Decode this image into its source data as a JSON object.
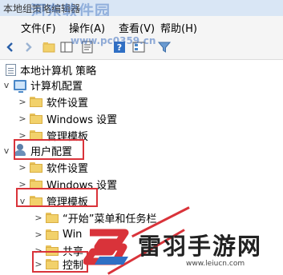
{
  "window": {
    "title": "本地组策略编辑器"
  },
  "watermarks": {
    "top": "河东软件园",
    "url_mid": "www.pc0359.cn",
    "brand": "雷羽手游网",
    "brand_url": "www.leiucn.com"
  },
  "menu": [
    "文件(F)",
    "操作(A)",
    "查看(V)",
    "帮助(H)"
  ],
  "toolbar": {
    "icons": [
      "back-arrow-icon",
      "forward-arrow-icon",
      "up-folder-icon",
      "show-hide-tree-icon",
      "properties-icon",
      "help-icon",
      "export-list-icon",
      "filter-icon"
    ]
  },
  "tree": {
    "root": "本地计算机 策略",
    "computer_config": "计算机配置",
    "computer_children": [
      "软件设置",
      "Windows 设置",
      "管理模板"
    ],
    "user_config": "用户配置",
    "user_children": [
      "软件设置",
      "Windows 设置",
      "管理模板"
    ],
    "admin_templates_children": [
      "“开始”菜单和任务栏",
      "Win",
      "共享",
      "控制"
    ]
  },
  "colors": {
    "highlight": "#d9333a",
    "folder": "#f2d16b",
    "titlebar": "#d9e6f5"
  }
}
